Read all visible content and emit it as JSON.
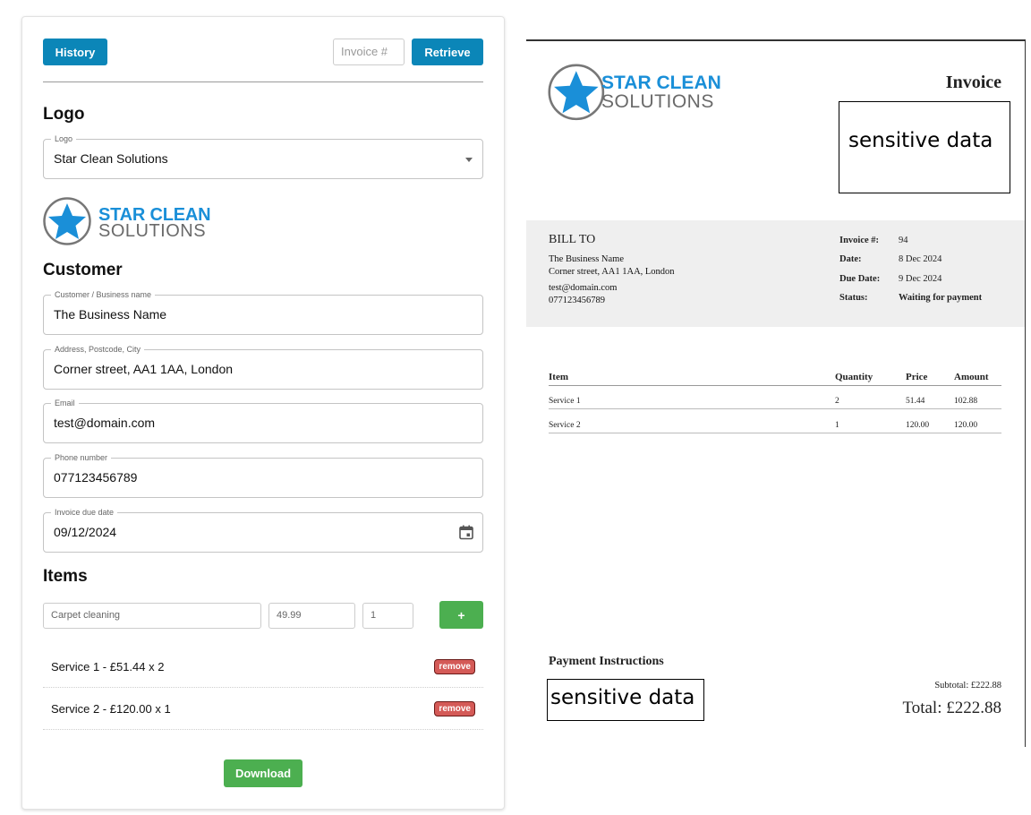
{
  "form": {
    "history_label": "History",
    "invoice_placeholder": "Invoice #",
    "retrieve_label": "Retrieve",
    "logo_section_title": "Logo",
    "logo_field_label": "Logo",
    "logo_selected": "Star Clean Solutions",
    "logo_line1": "STAR CLEAN",
    "logo_line2": "SOLUTIONS",
    "customer_section_title": "Customer",
    "customer_name_label": "Customer / Business name",
    "customer_name": "The Business Name",
    "address_label": "Address, Postcode, City",
    "address": "Corner street, AA1 1AA, London",
    "email_label": "Email",
    "email": "test@domain.com",
    "phone_label": "Phone number",
    "phone": "077123456789",
    "due_date_label": "Invoice due date",
    "due_date": "09/12/2024",
    "items_section_title": "Items",
    "new_item_description": "Carpet cleaning",
    "new_item_price": "49.99",
    "new_item_qty": "1",
    "add_label": "+",
    "items": [
      {
        "text": "Service 1 - £51.44 x 2",
        "remove_label": "remove"
      },
      {
        "text": "Service 2 - £120.00 x 1",
        "remove_label": "remove"
      }
    ],
    "download_label": "Download"
  },
  "invoice": {
    "logo_line1": "STAR CLEAN",
    "logo_line2": "SOLUTIONS",
    "title": "Invoice",
    "sensitive_top": "sensitive data",
    "bill_to_heading": "BILL TO",
    "bill_name": "The Business Name",
    "bill_address": "Corner street, AA1 1AA, London",
    "bill_email": "test@domain.com",
    "bill_phone": "077123456789",
    "invoice_no_label": "Invoice #:",
    "invoice_no": "94",
    "date_label": "Date:",
    "date": "8 Dec 2024",
    "due_label": "Due Date:",
    "due": "9 Dec 2024",
    "status_label": "Status:",
    "status": "Waiting for payment",
    "col_item": "Item",
    "col_qty": "Quantity",
    "col_price": "Price",
    "col_amount": "Amount",
    "rows": [
      {
        "item": "Service 1",
        "qty": "2",
        "price": "51.44",
        "amount": "102.88"
      },
      {
        "item": "Service 2",
        "qty": "1",
        "price": "120.00",
        "amount": "120.00"
      }
    ],
    "payment_heading": "Payment Instructions",
    "sensitive_bottom": "sensitive data",
    "subtotal": "Subtotal: £222.88",
    "total": "Total: £222.88"
  },
  "colors": {
    "primary_blue": "#0b86b8",
    "green": "#4caf50",
    "remove_red": "#d45a57",
    "logo_blue": "#1a8fd8"
  }
}
